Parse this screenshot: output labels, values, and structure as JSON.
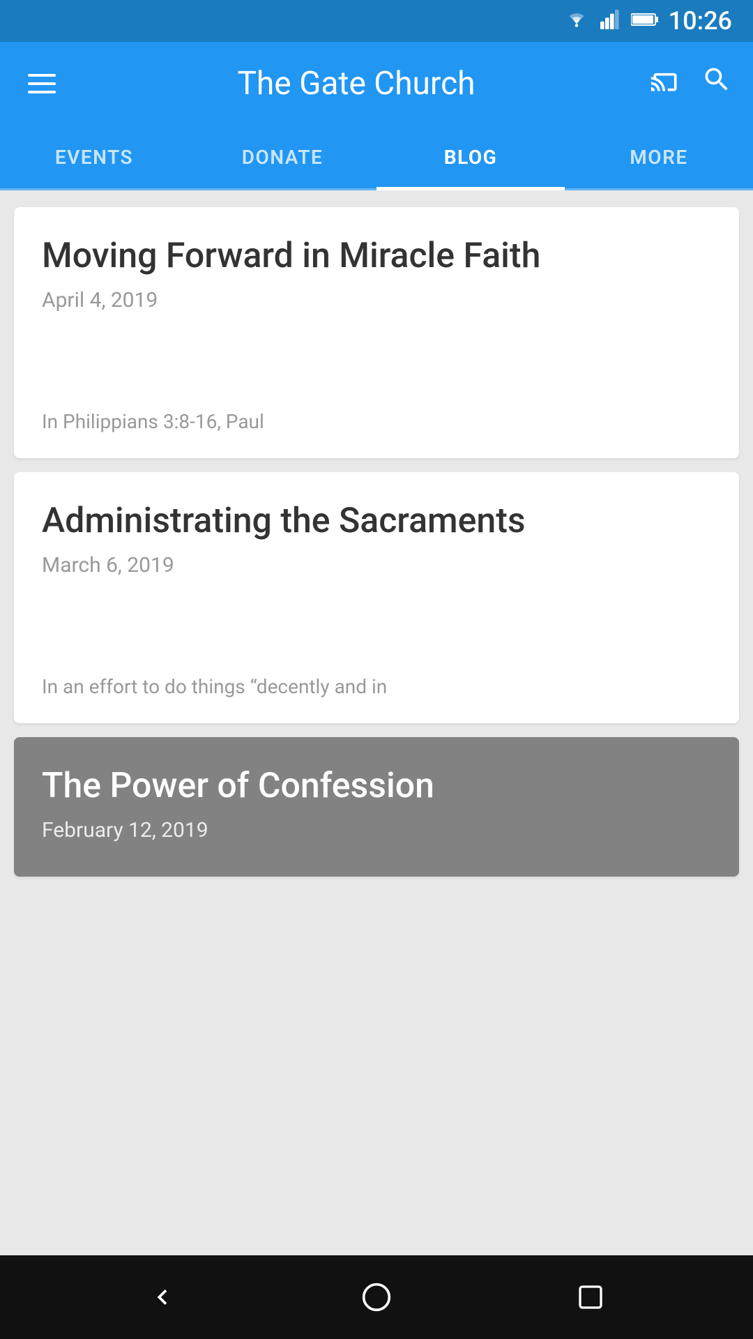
{
  "statusBar": {
    "time": "10:26"
  },
  "appBar": {
    "title": "The Gate Church",
    "hamburgerLabel": "Menu",
    "castLabel": "Cast",
    "searchLabel": "Search"
  },
  "tabs": [
    {
      "id": "events",
      "label": "EVENTS",
      "active": false
    },
    {
      "id": "donate",
      "label": "DONATE",
      "active": false
    },
    {
      "id": "blog",
      "label": "BLOG",
      "active": true
    },
    {
      "id": "more",
      "label": "MORE",
      "active": false
    }
  ],
  "blogPosts": [
    {
      "id": 1,
      "title": "Moving Forward in Miracle Faith",
      "date": "April 4, 2019",
      "meta": "In Philippians 3:8-16, Paul",
      "hasImage": false
    },
    {
      "id": 2,
      "title": "Administrating the Sacraments",
      "date": "March 6, 2019",
      "meta": "In an effort to do things “decently and in",
      "hasImage": false
    },
    {
      "id": 3,
      "title": "The Power of Confession",
      "date": "February 12, 2019",
      "meta": "",
      "hasImage": true
    }
  ],
  "navBar": {
    "backLabel": "Back",
    "homeLabel": "Home",
    "recentLabel": "Recent"
  }
}
